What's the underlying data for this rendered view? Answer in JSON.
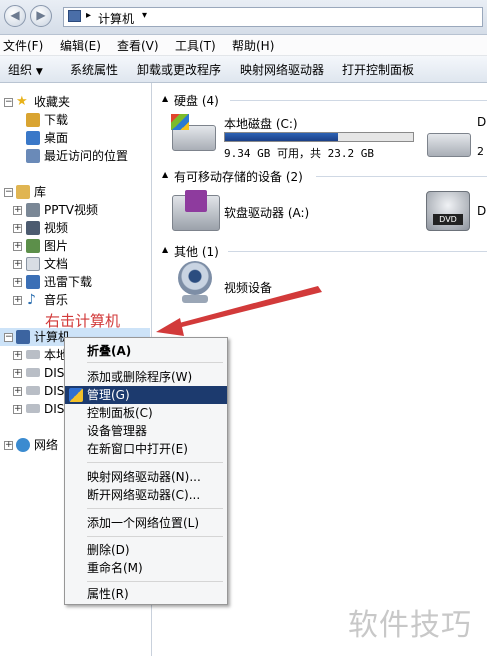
{
  "address_bar": {
    "path": "计算机"
  },
  "menubar": [
    {
      "label": "文件(F)"
    },
    {
      "label": "编辑(E)"
    },
    {
      "label": "查看(V)"
    },
    {
      "label": "工具(T)"
    },
    {
      "label": "帮助(H)"
    }
  ],
  "toolbar": [
    {
      "label": "组织"
    },
    {
      "label": "系统属性"
    },
    {
      "label": "卸载或更改程序"
    },
    {
      "label": "映射网络驱动器"
    },
    {
      "label": "打开控制面板"
    }
  ],
  "nav_pane": {
    "favorites": {
      "label": "收藏夹",
      "items": [
        {
          "label": "下载"
        },
        {
          "label": "桌面"
        },
        {
          "label": "最近访问的位置"
        }
      ]
    },
    "libraries": {
      "label": "库",
      "items": [
        {
          "label": "PPTV视频"
        },
        {
          "label": "视频"
        },
        {
          "label": "图片"
        },
        {
          "label": "文档"
        },
        {
          "label": "迅雷下载"
        },
        {
          "label": "音乐"
        }
      ]
    },
    "computer": {
      "label": "计算机",
      "items": [
        {
          "label": "本地"
        },
        {
          "label": "DIS"
        },
        {
          "label": "DIS"
        },
        {
          "label": "DIS"
        }
      ]
    },
    "network": {
      "label": "网络"
    }
  },
  "content": {
    "groups": [
      {
        "title": "硬盘 (4)",
        "items": [
          {
            "name": "本地磁盘 (C:)",
            "info": "9.34 GB 可用，共 23.2 GB",
            "used_fraction": 0.6
          },
          {
            "name": "DI",
            "info": "2"
          }
        ]
      },
      {
        "title": "有可移动存储的设备 (2)",
        "items": [
          {
            "name": "软盘驱动器 (A:)"
          },
          {
            "name": "D"
          }
        ]
      },
      {
        "title": "其他 (1)",
        "items": [
          {
            "name": "视频设备"
          }
        ]
      }
    ]
  },
  "annotation": "右击计算机",
  "context_menu": {
    "items": [
      {
        "label": "折叠(A)",
        "bold": true
      },
      {
        "separator": true
      },
      {
        "label": "添加或删除程序(W)"
      },
      {
        "label": "管理(G)",
        "highlighted": true
      },
      {
        "label": "控制面板(C)"
      },
      {
        "label": "设备管理器"
      },
      {
        "label": "在新窗口中打开(E)"
      },
      {
        "separator": true
      },
      {
        "label": "映射网络驱动器(N)..."
      },
      {
        "label": "断开网络驱动器(C)..."
      },
      {
        "separator": true
      },
      {
        "label": "添加一个网络位置(L)"
      },
      {
        "separator": true
      },
      {
        "label": "删除(D)"
      },
      {
        "label": "重命名(M)"
      },
      {
        "separator": true
      },
      {
        "label": "属性(R)"
      }
    ]
  },
  "watermark": "软件技巧",
  "colors": {
    "highlight": "#1c3a6e",
    "annotation": "#d23a3a",
    "drive_bar": "#1f4a9a"
  }
}
